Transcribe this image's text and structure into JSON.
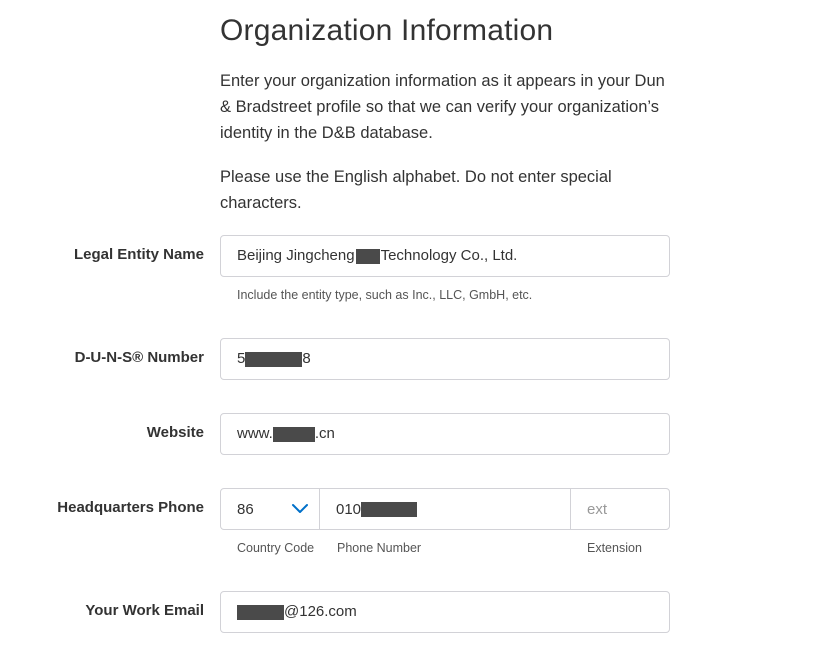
{
  "page": {
    "title": "Organization Information",
    "intro_p1": "Enter your organization information as it appears in your Dun & Bradstreet profile so that we can verify your organization’s identity in the D&B database.",
    "intro_p2": "Please use the English alphabet. Do not enter special characters."
  },
  "form": {
    "legal_entity": {
      "label": "Legal Entity Name",
      "value_prefix": "Beijing Jingcheng",
      "value_suffix": " Technology Co., Ltd.",
      "hint": "Include the entity type, such as Inc., LLC, GmbH, etc."
    },
    "duns": {
      "label": "D-U-N-S® Number",
      "value_prefix": "5",
      "value_suffix": "8"
    },
    "website": {
      "label": "Website",
      "value_prefix": "www.",
      "value_suffix": ".cn"
    },
    "hq_phone": {
      "label": "Headquarters Phone",
      "country_code": "86",
      "phone_prefix": "010",
      "ext_placeholder": "ext",
      "country_code_hint": "Country Code",
      "phone_number_hint": "Phone Number",
      "extension_hint": "Extension"
    },
    "work_email": {
      "label": "Your Work Email",
      "value_suffix": "@126.com"
    }
  },
  "colors": {
    "accent": "#0070c9",
    "border": "#d2d2d7",
    "text": "#333333"
  }
}
